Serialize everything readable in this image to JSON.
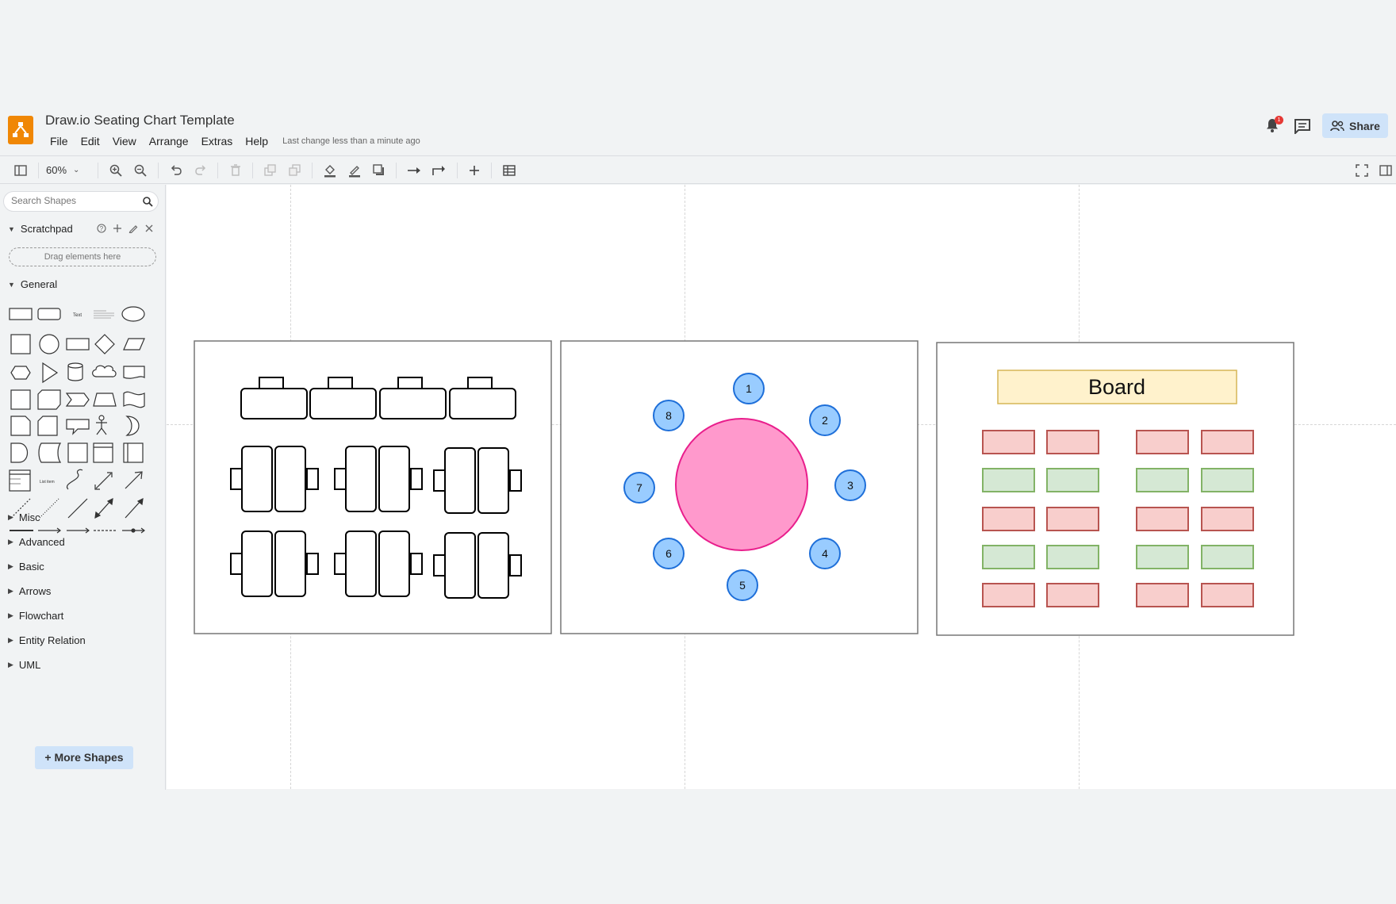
{
  "header": {
    "title": "Draw.io Seating Chart Template",
    "menu": [
      "File",
      "Edit",
      "View",
      "Arrange",
      "Extras",
      "Help"
    ],
    "last_change": "Last change less than a minute ago",
    "notification_count": "1",
    "share_label": "Share"
  },
  "toolbar": {
    "zoom": "60%"
  },
  "sidebar": {
    "search_placeholder": "Search Shapes",
    "scratchpad": {
      "title": "Scratchpad",
      "drop_hint": "Drag elements here"
    },
    "general_title": "General",
    "collapsed_sections": [
      "Misc",
      "Advanced",
      "Basic",
      "Arrows",
      "Flowchart",
      "Entity Relation",
      "UML"
    ],
    "more_shapes_label": "+ More Shapes"
  },
  "diagram": {
    "round_table": {
      "seats": [
        "1",
        "2",
        "3",
        "4",
        "5",
        "6",
        "7",
        "8"
      ],
      "table_color": "#ff99cc",
      "table_stroke": "#e91e8c",
      "seat_color": "#99ccff",
      "seat_stroke": "#1e6fd9"
    },
    "classroom": {
      "board_label": "Board",
      "board_fill": "#fff2cc",
      "board_stroke": "#d6b656",
      "desk_colors": {
        "red_fill": "#f8cecc",
        "red_stroke": "#b85450",
        "green_fill": "#d5e8d4",
        "green_stroke": "#82b366"
      }
    }
  }
}
